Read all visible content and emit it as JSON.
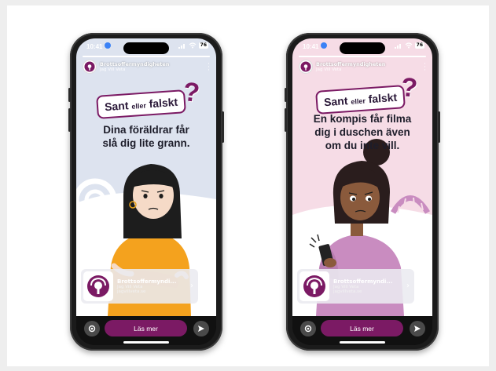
{
  "phones": [
    {
      "status_time": "10:41",
      "battery": "76",
      "account_name": "Brottsoffermyndigheten",
      "account_sub": "Jag Vill Veta",
      "badge_main": "Sant",
      "badge_small": "eller",
      "badge_end": "falskt",
      "headline_lines": [
        "Dina föräldrar får",
        "slå dig lite grann."
      ],
      "card_title": "Brottsoffermyndi...",
      "card_sub": "Jag Vill Veta",
      "card_url": "jagvillveta.se",
      "cta_label": "Läs mer",
      "bg_color": "#dde3ef"
    },
    {
      "status_time": "10:41",
      "battery": "76",
      "account_name": "Brottsoffermyndigheten",
      "account_sub": "Jag Vill Veta",
      "badge_main": "Sant",
      "badge_small": "eller",
      "badge_end": "falskt",
      "headline_lines": [
        "En kompis får filma",
        "dig i duschen även",
        "om du inte vill."
      ],
      "card_title": "Brottsoffermyndi...",
      "card_sub": "Jag Vill Veta",
      "card_url": "jagvillveta.se",
      "cta_label": "Läs mer",
      "bg_color": "#f6dce6"
    }
  ],
  "colors": {
    "brand_purple": "#7b1a64",
    "shirt_orange": "#f4a21e",
    "shirt_purple": "#c98cc0"
  },
  "icons": [
    "signal-icon",
    "wifi-icon",
    "battery-icon",
    "location-icon",
    "more-icon",
    "chevron-right-icon",
    "camera-icon",
    "send-icon"
  ]
}
